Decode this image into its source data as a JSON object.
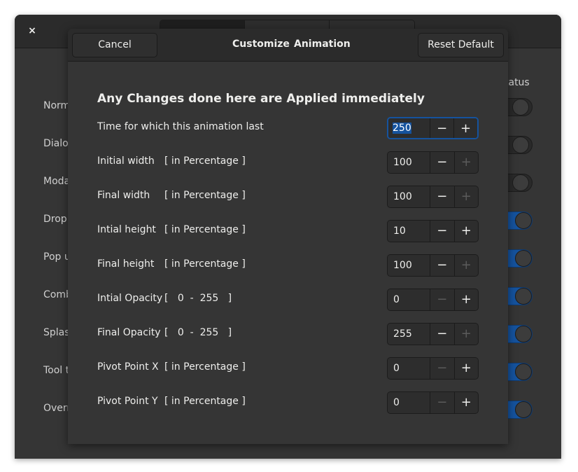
{
  "background": {
    "close_glyph": "×",
    "tabs": [
      "",
      "",
      ""
    ],
    "status_header": "tatus",
    "rows": [
      {
        "label": "Norm",
        "switch": "off"
      },
      {
        "label": "Dialo",
        "switch": "off"
      },
      {
        "label": "Moda",
        "switch": "off"
      },
      {
        "label": "Drop",
        "switch": "on"
      },
      {
        "label": "Pop u",
        "switch": "on"
      },
      {
        "label": "Comb",
        "switch": "on"
      },
      {
        "label": "Splas",
        "switch": "on"
      },
      {
        "label": "Tool t",
        "switch": "on"
      },
      {
        "label": "Overr",
        "switch": "on"
      }
    ]
  },
  "dialog": {
    "cancel_label": "Cancel",
    "title_part1": "Customize",
    "title_part2": "Animation",
    "reset_label": "Reset Default",
    "heading": "Any Changes done here are Applied immediately",
    "minus_glyph": "−",
    "plus_glyph": "+",
    "rows": [
      {
        "label": "Time for which this animation last",
        "unit": "",
        "value": "250",
        "minus_enabled": true,
        "plus_enabled": true,
        "focused": true
      },
      {
        "label": "Initial width",
        "unit": "[ in Percentage ]",
        "value": "100",
        "minus_enabled": true,
        "plus_enabled": false
      },
      {
        "label": "Final width",
        "unit": "[ in Percentage ]",
        "value": "100",
        "minus_enabled": true,
        "plus_enabled": false
      },
      {
        "label": "Intial height",
        "unit": "[ in Percentage ]",
        "value": "10",
        "minus_enabled": true,
        "plus_enabled": true
      },
      {
        "label": "Final height",
        "unit": "[ in Percentage ]",
        "value": "100",
        "minus_enabled": true,
        "plus_enabled": false
      },
      {
        "label": "Intial Opacity",
        "unit": "[   0  -  255   ]",
        "value": "0",
        "minus_enabled": false,
        "plus_enabled": true
      },
      {
        "label": "Final Opacity",
        "unit": "[   0  -  255   ]",
        "value": "255",
        "minus_enabled": true,
        "plus_enabled": false
      },
      {
        "label": "Pivot Point X",
        "unit": "[ in Percentage ]",
        "value": "0",
        "minus_enabled": false,
        "plus_enabled": true
      },
      {
        "label": "Pivot Point Y",
        "unit": "[ in Percentage ]",
        "value": "0",
        "minus_enabled": false,
        "plus_enabled": true
      }
    ]
  }
}
